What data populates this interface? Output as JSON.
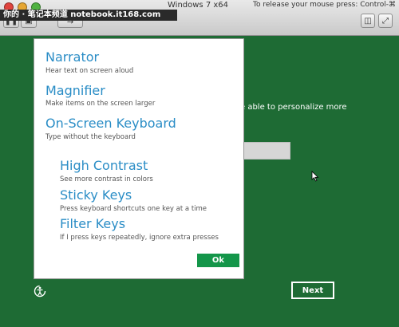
{
  "window": {
    "title": "Windows 7 x64",
    "release_hint": "To release your mouse press: Control-⌘"
  },
  "watermark": "你的 · 笔记本频道 notebook.it168.com",
  "background_page": {
    "text": "e able to personalize more",
    "next_label": "Next"
  },
  "ease_panel": {
    "options": [
      {
        "title": "Narrator",
        "desc": "Hear text on screen aloud"
      },
      {
        "title": "Magnifier",
        "desc": "Make items on the screen larger"
      },
      {
        "title": "On-Screen Keyboard",
        "desc": "Type without the keyboard"
      },
      {
        "title": "High Contrast",
        "desc": "See more contrast in colors"
      },
      {
        "title": "Sticky Keys",
        "desc": "Press keyboard shortcuts one key at a time"
      },
      {
        "title": "Filter Keys",
        "desc": "If I press keys repeatedly, ignore extra presses"
      }
    ],
    "ok_label": "Ok"
  },
  "colors": {
    "background": "#1e6b34",
    "accent_text": "#2a8dc6",
    "ok_button": "#14964a"
  },
  "icons": [
    "ease-of-access-icon",
    "mouse-cursor-icon"
  ]
}
